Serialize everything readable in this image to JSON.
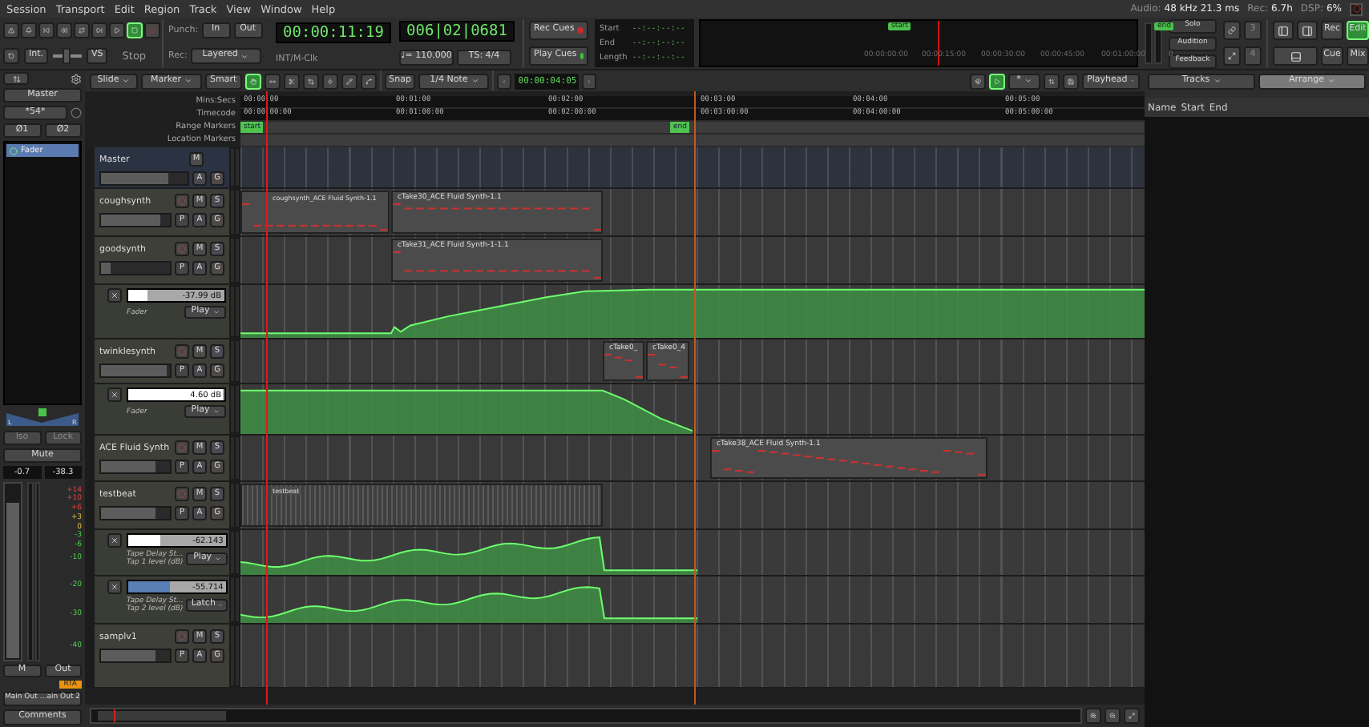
{
  "menu": [
    "Session",
    "Transport",
    "Edit",
    "Region",
    "Track",
    "View",
    "Window",
    "Help"
  ],
  "status": [
    {
      "label": "Audio:",
      "value": "48 kHz 21.3 ms"
    },
    {
      "label": "Rec:",
      "value": "6.7h"
    },
    {
      "label": "DSP:",
      "value": "6%"
    }
  ],
  "transport": {
    "buttons": [
      {
        "kind": "panic",
        "selected": false
      },
      {
        "kind": "metronome",
        "selected": false
      },
      {
        "kind": "start",
        "selected": false
      },
      {
        "kind": "rewind",
        "selected": false
      },
      {
        "kind": "loop",
        "selected": false
      },
      {
        "kind": "end",
        "selected": false
      },
      {
        "kind": "play",
        "selected": false
      },
      {
        "kind": "stop",
        "selected": true
      },
      {
        "kind": "record",
        "selected": false
      }
    ],
    "sync": "Int.",
    "shuttle": {
      "level": 0.45
    },
    "varispeed": "VS",
    "state": "Stop",
    "punch_label": "Punch:",
    "punch_in": "In",
    "punch_out": "Out",
    "rec_label": "Rec:",
    "rec_mode": "Layered"
  },
  "clock": {
    "time": "00:00:11:19",
    "source": "INT/M-Clk"
  },
  "bbt": {
    "time": "006|02|0681",
    "tempo": "♩= 110.000",
    "meter": "TS: 4/4"
  },
  "cues": [
    {
      "label": "Rec Cues",
      "color": "#cc2a2a"
    },
    {
      "label": "Play Cues",
      "color": "#37c837"
    }
  ],
  "range": [
    {
      "label": "Start",
      "value": "--:--:--:--"
    },
    {
      "label": "End",
      "value": "--:--:--:--"
    },
    {
      "label": "Length",
      "value": "--:--:--:--"
    }
  ],
  "mini_timeline": {
    "markers": [
      "start",
      "end"
    ],
    "ticks": [
      "00:00:00:00",
      "00:00:15:00",
      "00:00:30:00",
      "00:00:45:00",
      "00:01:00:00",
      "0"
    ]
  },
  "monitor": [
    "Solo",
    "Audition",
    "Feedback"
  ],
  "counters": [
    "3",
    "4"
  ],
  "views": [
    {
      "label": "Rec",
      "selected": false
    },
    {
      "label": "Edit",
      "selected": true
    },
    {
      "label": "Cue",
      "selected": false
    },
    {
      "label": "Mix",
      "selected": false
    }
  ],
  "edit": {
    "mode": "Slide",
    "marker": "Marker",
    "smart": "Smart",
    "tools": [
      {
        "kind": "grab",
        "selected": true
      },
      {
        "kind": "range",
        "selected": false
      },
      {
        "kind": "cut",
        "selected": false
      },
      {
        "kind": "stretch",
        "selected": false
      },
      {
        "kind": "audition",
        "selected": false
      },
      {
        "kind": "draw",
        "selected": false
      },
      {
        "kind": "content",
        "selected": false
      }
    ],
    "snap": "Snap",
    "grid": "1/4 Note",
    "nudge": "00:00:04:05",
    "zoom_focus": "*",
    "follow": "Playhead",
    "list": "Tracks",
    "layout": "Arrange"
  },
  "strip": {
    "name": "Master",
    "input": "*54*",
    "phase": [
      "Ø1",
      "Ø2"
    ],
    "processors": [
      {
        "label": "Fader",
        "selected": true
      }
    ],
    "pan": [
      "L",
      "R"
    ],
    "iso": "Iso",
    "lock": "Lock",
    "mute": "Mute",
    "gain": "-0.7",
    "peak": "-38.3",
    "level": 0.88,
    "scale": [
      "+14",
      "+10",
      "+6",
      "+3",
      "0",
      "-3",
      "-6",
      "-10",
      "-20",
      "-30",
      "-40"
    ],
    "meter_point": "M",
    "output_meter": "Out",
    "meter_type": "RTA",
    "output": "Main Out …ain Out 2",
    "comments": "Comments"
  },
  "rulers": [
    {
      "label": "Mins:Secs",
      "ticks": [
        "00:00:00",
        "00:01:00",
        "00:02:00",
        "00:03:00",
        "00:04:00",
        "00:05:00"
      ]
    },
    {
      "label": "Timecode",
      "ticks": [
        "00:00:00:00",
        "00:01:00:00",
        "00:02:00:00",
        "00:03:00:00",
        "00:04:00:00",
        "00:05:00:00"
      ]
    },
    {
      "label": "Range Markers",
      "markers": [
        "start",
        "end"
      ]
    },
    {
      "label": "Location Markers"
    }
  ],
  "tracks": [
    {
      "name": "Master",
      "kind": "master",
      "level": 0.78,
      "top": [
        {
          "kind": "mute",
          "label": "M"
        }
      ],
      "bottom": [
        {
          "kind": "automation",
          "label": "A"
        },
        {
          "kind": "group",
          "label": "G"
        }
      ]
    },
    {
      "name": "coughsynth",
      "kind": "midi",
      "level": 0.85,
      "top": [
        {
          "kind": "record"
        },
        {
          "kind": "mute",
          "label": "M"
        },
        {
          "kind": "solo",
          "label": "S"
        }
      ],
      "bottom": [
        {
          "kind": "playlist",
          "label": "P"
        },
        {
          "kind": "automation",
          "label": "A"
        },
        {
          "kind": "group",
          "label": "G"
        }
      ],
      "regions": [
        {
          "label": "coughsynth_ACE Fluid Synth-1.1"
        },
        {
          "label": "cTake30_ACE Fluid Synth-1.1"
        }
      ]
    },
    {
      "name": "goodsynth",
      "kind": "midi",
      "level": 0.15,
      "top": [
        {
          "kind": "record"
        },
        {
          "kind": "mute",
          "label": "M"
        },
        {
          "kind": "solo",
          "label": "S"
        }
      ],
      "bottom": [
        {
          "kind": "playlist",
          "label": "P"
        },
        {
          "kind": "automation",
          "label": "A"
        },
        {
          "kind": "group",
          "label": "G"
        }
      ],
      "regions": [
        {
          "label": "cTake31_ACE Fluid Synth-1-1.1"
        }
      ],
      "automation": [
        {
          "value": "-37.99 dB",
          "label": "Fader",
          "mode": "Play",
          "level": 0.2,
          "color": "#ffffff"
        }
      ]
    },
    {
      "name": "twinklesynth",
      "kind": "midi",
      "level": 0.95,
      "top": [
        {
          "kind": "record"
        },
        {
          "kind": "mute",
          "label": "M"
        },
        {
          "kind": "solo",
          "label": "S"
        }
      ],
      "bottom": [
        {
          "kind": "playlist",
          "label": "P"
        },
        {
          "kind": "automation",
          "label": "A"
        },
        {
          "kind": "group",
          "label": "G"
        }
      ],
      "regions": [
        {
          "label": "cTake0_"
        },
        {
          "label": "cTake0_4"
        }
      ],
      "automation": [
        {
          "value": "4.60 dB",
          "label": "Fader",
          "mode": "Play",
          "level": 0.98,
          "color": "#ffffff"
        }
      ]
    },
    {
      "name": "ACE Fluid Synth",
      "kind": "midi",
      "level": 0.8,
      "top": [
        {
          "kind": "record"
        },
        {
          "kind": "mute",
          "label": "M"
        },
        {
          "kind": "solo",
          "label": "S"
        }
      ],
      "bottom": [
        {
          "kind": "playlist",
          "label": "P"
        },
        {
          "kind": "automation",
          "label": "A"
        },
        {
          "kind": "group",
          "label": "G"
        }
      ],
      "regions": [
        {
          "label": "cTake38_ACE Fluid Synth-1.1"
        }
      ]
    },
    {
      "name": "testbeat",
      "kind": "midi",
      "level": 0.8,
      "top": [
        {
          "kind": "record"
        },
        {
          "kind": "mute",
          "label": "M"
        },
        {
          "kind": "solo",
          "label": "S"
        }
      ],
      "bottom": [
        {
          "kind": "playlist",
          "label": "P"
        },
        {
          "kind": "automation",
          "label": "A"
        },
        {
          "kind": "group",
          "label": "G"
        }
      ],
      "regions": [
        {
          "label": "testbeat"
        }
      ],
      "automation": [
        {
          "value": "-62.143",
          "label": "Tape Delay St...",
          "parameter": "Tap 1 level (dB)",
          "mode": "Play",
          "level": 0.33,
          "color": "#ffffff"
        },
        {
          "value": "-55.714",
          "label": "Tape Delay St...",
          "parameter": "Tap 2 level (dB)",
          "mode": "Latch",
          "level": 0.42,
          "color": "#5a7fb5"
        }
      ]
    },
    {
      "name": "samplv1",
      "kind": "midi",
      "level": 0.8,
      "top": [
        {
          "kind": "record"
        },
        {
          "kind": "mute",
          "label": "M"
        },
        {
          "kind": "solo",
          "label": "S"
        }
      ],
      "bottom": [
        {
          "kind": "playlist",
          "label": "P"
        },
        {
          "kind": "automation",
          "label": "A"
        },
        {
          "kind": "group",
          "label": "G"
        }
      ]
    }
  ],
  "region_list": {
    "columns": [
      "Name",
      "Start",
      "End"
    ]
  }
}
